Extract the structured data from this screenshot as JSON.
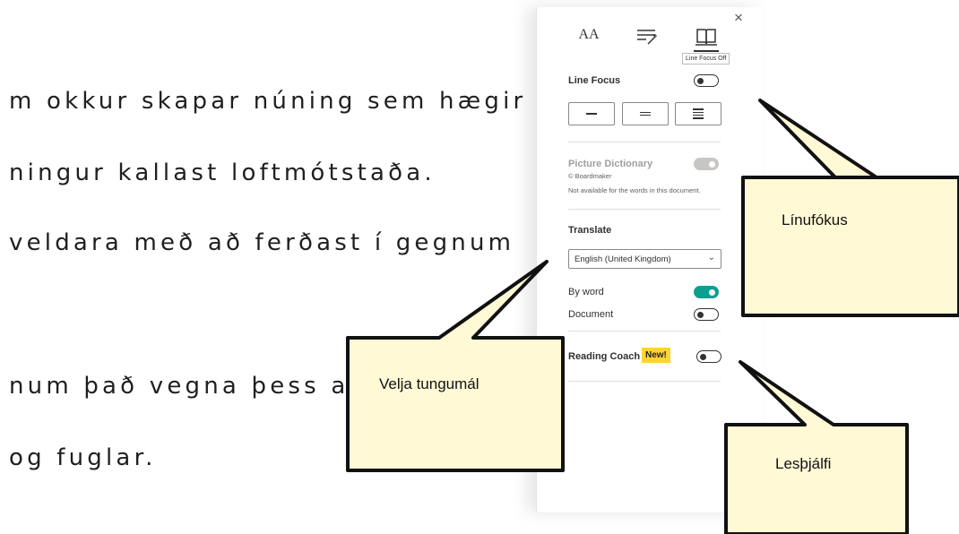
{
  "reader": {
    "lines": [
      "m okkur skapar núning sem hægir",
      "ningur kallast loftmótstaða.",
      "veldara með að ferðast í gegnum",
      "num það vegna þess a",
      "og fuglar."
    ]
  },
  "panel": {
    "close_glyph": "×",
    "tabs": {
      "text_glyph": "AA"
    },
    "tooltip": "Line Focus Off",
    "line_focus": {
      "label": "Line Focus"
    },
    "picture_dictionary": {
      "label": "Picture Dictionary",
      "provider": "© Boardmaker",
      "note": "Not available for the words in this document."
    },
    "translate": {
      "label": "Translate",
      "selected_language": "English (United Kingdom)",
      "by_word_label": "By word",
      "document_label": "Document"
    },
    "reading_coach": {
      "label": "Reading Coach",
      "badge": "New!"
    }
  },
  "callouts": {
    "line_focus": "Línufókus",
    "language": "Velja tungumál",
    "reading_coach": "Lesþjálfi"
  },
  "colors": {
    "toggle_on": "#0e9f8f",
    "badge": "#ffd335",
    "callout_fill": "#fff9d6"
  }
}
